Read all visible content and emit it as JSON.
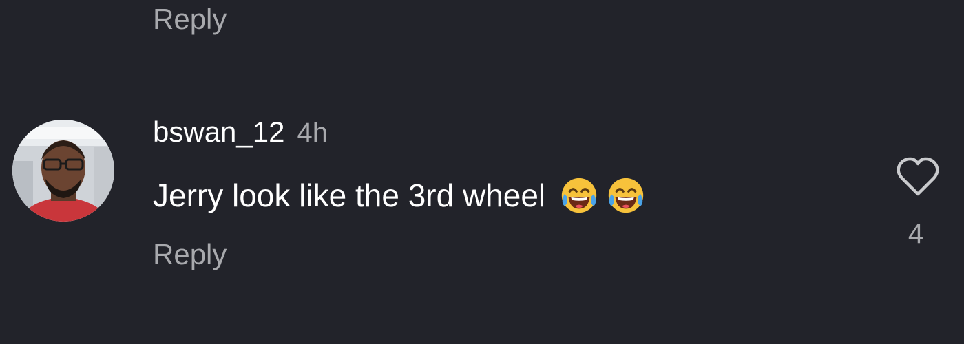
{
  "previous_comment": {
    "reply_label": "Reply"
  },
  "comment": {
    "avatar_icon": "user-avatar-photo",
    "username": "bswan_12",
    "timestamp": "4h",
    "text": "Jerry look like the 3rd wheel",
    "emojis": [
      "face-with-tears-of-joy-icon",
      "face-with-tears-of-joy-icon"
    ],
    "reply_label": "Reply",
    "like_icon": "heart-outline-icon",
    "like_count": "4"
  },
  "colors": {
    "background": "#22232a",
    "primary_text": "#ffffff",
    "secondary_text": "#a8a9ad",
    "emoji_yellow": "#f7c23b"
  }
}
